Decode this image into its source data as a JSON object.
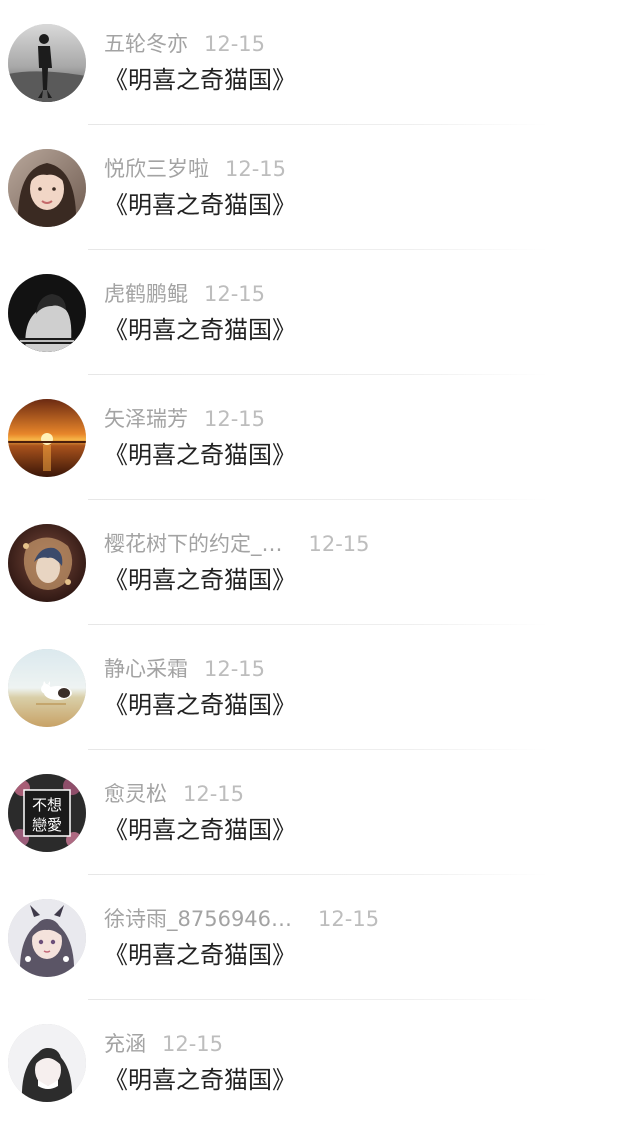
{
  "conversations": [
    {
      "name": "五轮冬亦",
      "time": "12-15",
      "message": "《明喜之奇猫国》",
      "avatar_icon": "bw-person-silhouette-avatar"
    },
    {
      "name": "悦欣三岁啦",
      "time": "12-15",
      "message": "《明喜之奇猫国》",
      "avatar_icon": "girl-selfie-avatar"
    },
    {
      "name": "虎鹤鹏鲲",
      "time": "12-15",
      "message": "《明喜之奇猫国》",
      "avatar_icon": "dark-portrait-avatar"
    },
    {
      "name": "矢泽瑞芳",
      "time": "12-15",
      "message": "《明喜之奇猫国》",
      "avatar_icon": "sunset-avatar"
    },
    {
      "name": "樱花树下的约定_…",
      "time": "12-15",
      "message": "《明喜之奇猫国》",
      "avatar_icon": "anime-art-avatar"
    },
    {
      "name": "静心采霜",
      "time": "12-15",
      "message": "《明喜之奇猫国》",
      "avatar_icon": "cat-on-beach-avatar"
    },
    {
      "name": "愈灵松",
      "time": "12-15",
      "message": "《明喜之奇猫国》",
      "avatar_icon": "text-collage-avatar",
      "avatar_text": [
        "不想",
        "戀愛"
      ]
    },
    {
      "name": "徐诗雨_8756946…",
      "time": "12-15",
      "message": "《明喜之奇猫国》",
      "avatar_icon": "anime-girl-avatar"
    },
    {
      "name": "充涵",
      "time": "12-15",
      "message": "《明喜之奇猫国》",
      "avatar_icon": "light-portrait-avatar"
    }
  ],
  "colors": {
    "name": "#a3a3a3",
    "time": "#bdbdbd",
    "message": "#222222",
    "divider": "#e7e7e7"
  }
}
